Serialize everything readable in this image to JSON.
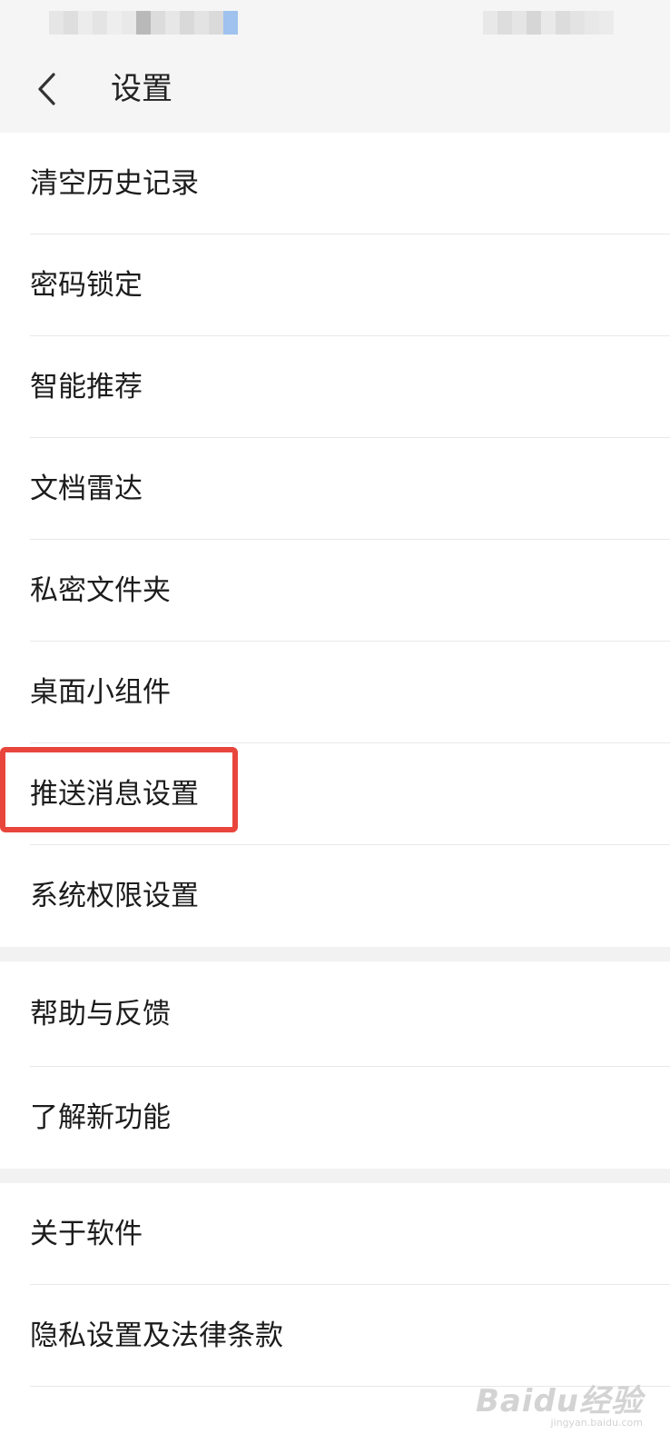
{
  "header": {
    "title": "设置",
    "back_icon": "chevron-left-icon"
  },
  "groups": [
    {
      "items": [
        {
          "label": "清空历史记录"
        },
        {
          "label": "密码锁定"
        },
        {
          "label": "智能推荐"
        },
        {
          "label": "文档雷达"
        },
        {
          "label": "私密文件夹"
        },
        {
          "label": "桌面小组件"
        },
        {
          "label": "推送消息设置",
          "highlighted": true
        },
        {
          "label": "系统权限设置"
        }
      ]
    },
    {
      "items": [
        {
          "label": "帮助与反馈"
        },
        {
          "label": "了解新功能"
        }
      ]
    },
    {
      "items": [
        {
          "label": "关于软件"
        },
        {
          "label": "隐私设置及法律条款"
        }
      ]
    }
  ],
  "watermark": {
    "main": "Baidu经验",
    "sub": "jingyan.baidu.com"
  },
  "colors": {
    "highlight": "#e8463c",
    "header_bg": "#f5f5f5",
    "section_gap": "#f2f2f2"
  }
}
